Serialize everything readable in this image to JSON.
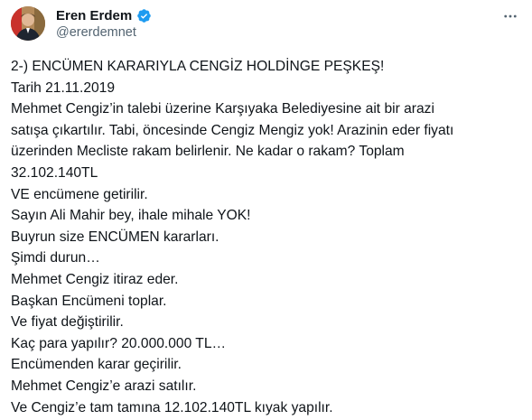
{
  "author": {
    "display_name": "Eren Erdem",
    "handle": "@ererdemnet",
    "verified": true,
    "avatar": "profile-photo",
    "verified_icon": "verified-badge-icon",
    "verified_color": "#1d9bf0"
  },
  "menu": {
    "icon": "more-horizontal-icon"
  },
  "tweet": {
    "lines": [
      "2-) ENCÜMEN KARARIYLA CENGİZ HOLDİNGE PEŞKEŞ!",
      "Tarih 21.11.2019",
      "Mehmet Cengiz’in talebi üzerine Karşıyaka Belediyesine ait bir arazi",
      "satışa çıkartılır. Tabi, öncesinde Cengiz Mengiz yok! Arazinin eder fiyatı",
      "üzerinden Mecliste rakam belirlenir. Ne kadar o rakam? Toplam",
      "32.102.140TL",
      "VE encümene getirilir.",
      "Sayın Ali Mahir bey, ihale mihale YOK!",
      "Buyrun size ENCÜMEN kararları.",
      "Şimdi durun…",
      "Mehmet Cengiz itiraz eder.",
      "Başkan Encümeni toplar.",
      "Ve fiyat değiştirilir.",
      "Kaç para yapılır? 20.000.000 TL…",
      "Encümenden karar geçirilir.",
      "Mehmet Cengiz’e arazi satılır.",
      "Ve Cengiz’e tam tamına 12.102.140TL kıyak yapılır."
    ]
  }
}
